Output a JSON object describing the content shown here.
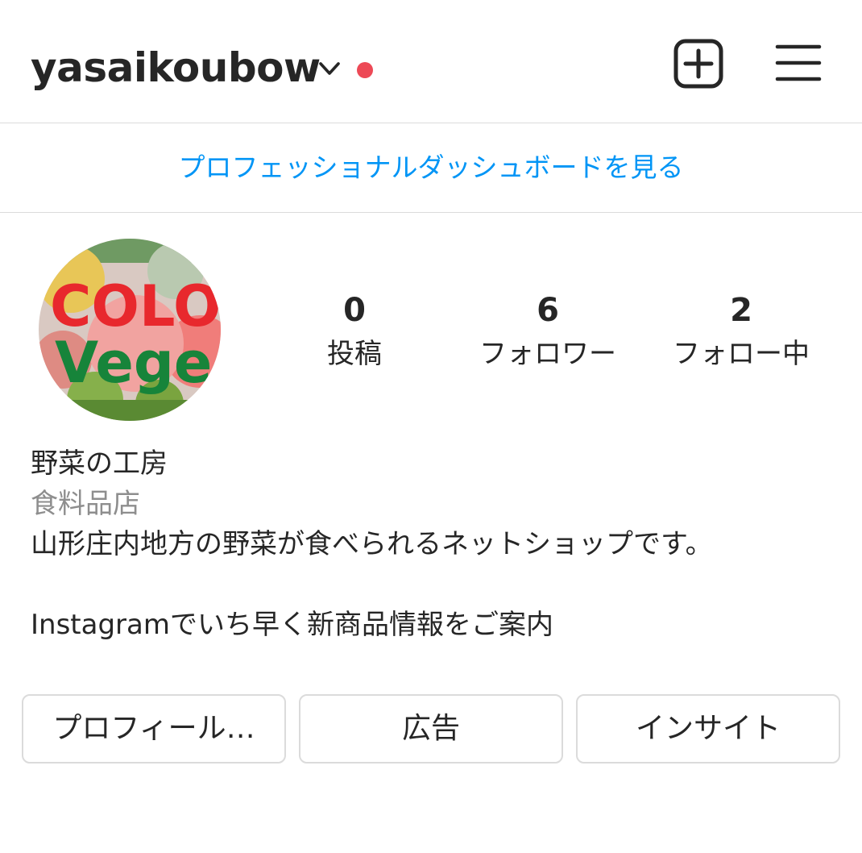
{
  "header": {
    "username": "yasaikoubow",
    "icons": {
      "account_switch": "chevron-down-icon",
      "notification": "notification-dot",
      "new_post": "plus-square-icon",
      "menu": "hamburger-menu-icon"
    },
    "notification_color": "#ed4956"
  },
  "dashboard": {
    "link_label": "プロフェッショナルダッシュボードを見る",
    "color": "#0095f6"
  },
  "profile": {
    "avatar": {
      "text_line1": "COLO",
      "text_line2": "Vege"
    },
    "stats": [
      {
        "value": "0",
        "label": "投稿"
      },
      {
        "value": "6",
        "label": "フォロワー"
      },
      {
        "value": "2",
        "label": "フォロー中"
      }
    ],
    "display_name": "野菜の工房",
    "category": "食料品店",
    "bio_line1": "山形庄内地方の野菜が食べられるネットショップです。",
    "bio_line2": "Instagramでいち早く新商品情報をご案内"
  },
  "buttons": {
    "edit_profile": "プロフィール…",
    "ads": "広告",
    "insights": "インサイト"
  }
}
